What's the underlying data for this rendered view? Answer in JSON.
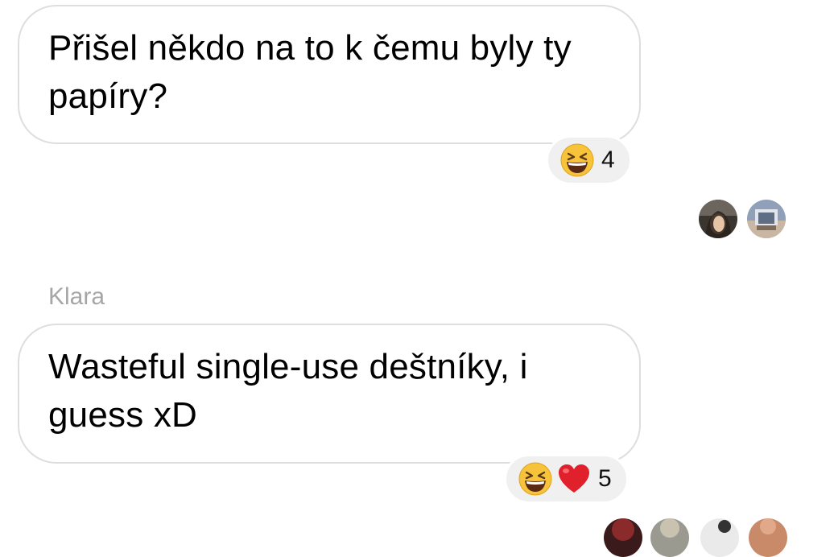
{
  "messages": [
    {
      "text": "Přišel někdo na to k čemu byly ty papíry?",
      "reactions": {
        "emojis": [
          "grinning-squinting-face"
        ],
        "count": "4"
      }
    },
    {
      "sender": "Klara",
      "text": "Wasteful single-use deštníky, i guess xD",
      "reactions": {
        "emojis": [
          "grinning-squinting-face",
          "red-heart"
        ],
        "count": "5"
      }
    }
  ],
  "colors": {
    "bubble_border": "#dedede",
    "reaction_bg": "#f0f0f0",
    "sender_text": "#a6a6a6",
    "heart": "#e0202a",
    "emoji_face": "#f7c33b"
  }
}
